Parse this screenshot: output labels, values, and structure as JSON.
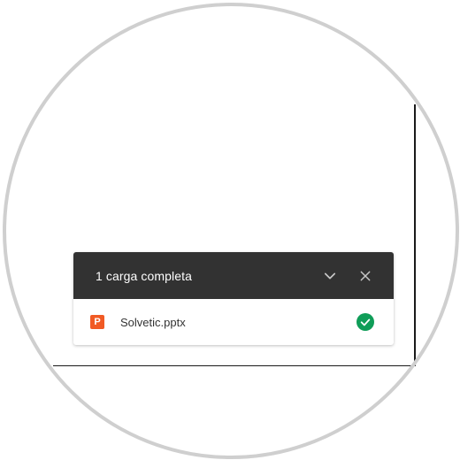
{
  "upload_panel": {
    "title": "1 carga completa",
    "collapse_icon": "chevron-down-icon",
    "close_icon": "close-icon",
    "files": [
      {
        "name": "Solvetic.pptx",
        "type_icon_letter": "P",
        "type_icon": "powerpoint-file-icon",
        "status_icon": "check-circle-icon"
      }
    ]
  },
  "colors": {
    "header_bg": "#323232",
    "header_text": "#ffffff",
    "file_icon": "#f15a24",
    "success": "#0f9d58",
    "frame": "#cfcfcf"
  }
}
